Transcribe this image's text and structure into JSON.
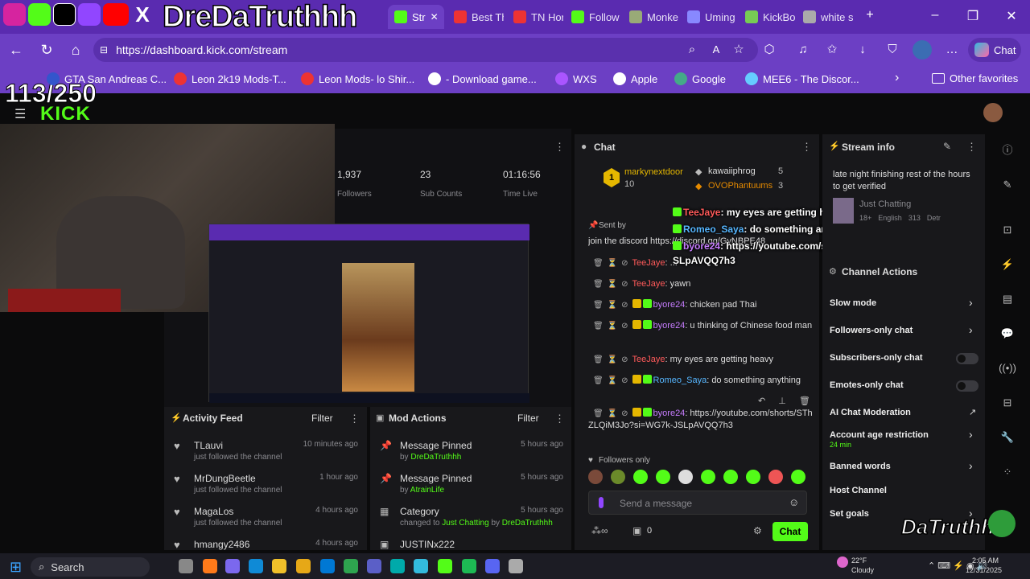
{
  "overlay": {
    "channel_name": "DreDaTruthhh",
    "goal_counter": "113/250",
    "watermark": "DaTruthh"
  },
  "browser": {
    "tabs": [
      {
        "label": "Str",
        "color": "#53fc18"
      },
      {
        "label": "Best Th",
        "color": "#e33"
      },
      {
        "label": "TN Hor",
        "color": "#e33"
      },
      {
        "label": "Follow",
        "color": "#53fc18"
      },
      {
        "label": "Monke",
        "color": "#9a7"
      },
      {
        "label": "Uming",
        "color": "#88f"
      },
      {
        "label": "KickBo",
        "color": "#7c5"
      },
      {
        "label": "white s",
        "color": "#aaa"
      }
    ],
    "url": "https://dashboard.kick.com/stream",
    "chat_button": "Chat",
    "bookmarks": [
      {
        "label": "GTA San Andreas C...",
        "color": "#35c"
      },
      {
        "label": "Leon 2k19 Mods-T...",
        "color": "#e33"
      },
      {
        "label": "Leon Mods- lo Shir...",
        "color": "#e33"
      },
      {
        "label": "- Download game...",
        "color": "#fff"
      },
      {
        "label": "WXS",
        "color": "#a5f"
      },
      {
        "label": "Apple",
        "color": "#fff"
      },
      {
        "label": "Google",
        "color": "#4a8"
      },
      {
        "label": "MEE6 - The Discor...",
        "color": "#6cf"
      }
    ],
    "other_favorites": "Other favorites"
  },
  "kick": {
    "logo": "KICK"
  },
  "stats": [
    {
      "value": "1,937",
      "label": "Followers"
    },
    {
      "value": "23",
      "label": "Sub Counts"
    },
    {
      "value": "01:16:56",
      "label": "Time Live"
    }
  ],
  "chat": {
    "title": "Chat",
    "leaderboard": [
      {
        "rank": "1",
        "name": "markynextdoor",
        "count": "10"
      },
      {
        "name": "kawaiiphrog",
        "count": "5"
      },
      {
        "name": "OVOPhantuums",
        "count": "3"
      }
    ],
    "pinned_sender": "Sent by",
    "pinned_text": "join the discord https://discord.gg/GyNBPE48",
    "messages": [
      {
        "user": "TeeJaye",
        "color": "#ff5a5a",
        "text": ": ..."
      },
      {
        "user": "TeeJaye",
        "color": "#ff5a5a",
        "text": ": yawn"
      },
      {
        "user": "byore24",
        "color": "#c77dff",
        "text": ": chicken pad Thai"
      },
      {
        "user": "byore24",
        "color": "#c77dff",
        "text": ": u thinking of Chinese food man"
      },
      {
        "user": "TeeJaye",
        "color": "#ff5a5a",
        "text": ": my eyes are getting heavy"
      },
      {
        "user": "Romeo_Saya",
        "color": "#56b6ff",
        "text": ": do something anything"
      },
      {
        "user": "byore24",
        "color": "#c77dff",
        "text": ": https://youtube.com/shorts/SThZLQiM3Jo?si=WG7k-JSLpAVQQ7h3"
      }
    ],
    "overlay_messages": [
      {
        "user": "TeeJaye",
        "text": ": my eyes are getting heavy"
      },
      {
        "user": "Romeo_Saya",
        "text": ": do something anything"
      },
      {
        "user": "byore24",
        "text": ": https://youtube.com/shorts/SThZLQiM3Jo?si=WG7k-JSLpAVQQ7h3"
      }
    ],
    "followers_only": "Followers only",
    "placeholder": "Send a message",
    "viewers": "0",
    "send_label": "Chat"
  },
  "stream_info": {
    "title": "Stream info",
    "stream_title": "late night finishing rest of the hours to get verified",
    "category": "Just Chatting",
    "tags": [
      "18+",
      "English",
      "313",
      "Detr"
    ]
  },
  "channel_actions": {
    "title": "Channel Actions",
    "items": [
      {
        "label": "Slow mode",
        "control": "chevron"
      },
      {
        "label": "Followers-only chat",
        "control": "chevron"
      },
      {
        "label": "Subscribers-only chat",
        "control": "toggle"
      },
      {
        "label": "Emotes-only chat",
        "control": "toggle"
      },
      {
        "label": "AI Chat Moderation",
        "control": "external"
      },
      {
        "label": "Account age restriction",
        "sub": "24 min",
        "control": "chevron"
      },
      {
        "label": "Banned words",
        "control": "chevron"
      },
      {
        "label": "Host Channel",
        "control": "none"
      },
      {
        "label": "Set goals",
        "control": "chevron"
      }
    ]
  },
  "activity_feed": {
    "title": "Activity Feed",
    "filter": "Filter",
    "items": [
      {
        "name": "TLauvi",
        "desc": "just followed the channel",
        "time": "10 minutes ago"
      },
      {
        "name": "MrDungBeetle",
        "desc": "just followed the channel",
        "time": "1 hour ago"
      },
      {
        "name": "MagaLos",
        "desc": "just followed the channel",
        "time": "4 hours ago"
      },
      {
        "name": "hmangy2486",
        "desc": "",
        "time": "4 hours ago"
      }
    ]
  },
  "mod_actions": {
    "title": "Mod Actions",
    "filter": "Filter",
    "items": [
      {
        "title": "Message Pinned",
        "by": "by",
        "user": "DreDaTruthhh",
        "time": "5 hours ago"
      },
      {
        "title": "Message Pinned",
        "by": "by",
        "user": "AtrainLife",
        "time": "5 hours ago"
      },
      {
        "title": "Category",
        "by": "changed to",
        "cat": "Just Chatting",
        "by2": "by",
        "user": "DreDaTruthhh",
        "time": "5 hours ago"
      },
      {
        "title": "JUSTINx222",
        "by": "",
        "user": "",
        "time": ""
      }
    ]
  },
  "taskbar": {
    "search": "Search",
    "weather_temp": "22°F",
    "weather_desc": "Cloudy",
    "time": "2:05 AM",
    "date": "12/31/2025"
  }
}
